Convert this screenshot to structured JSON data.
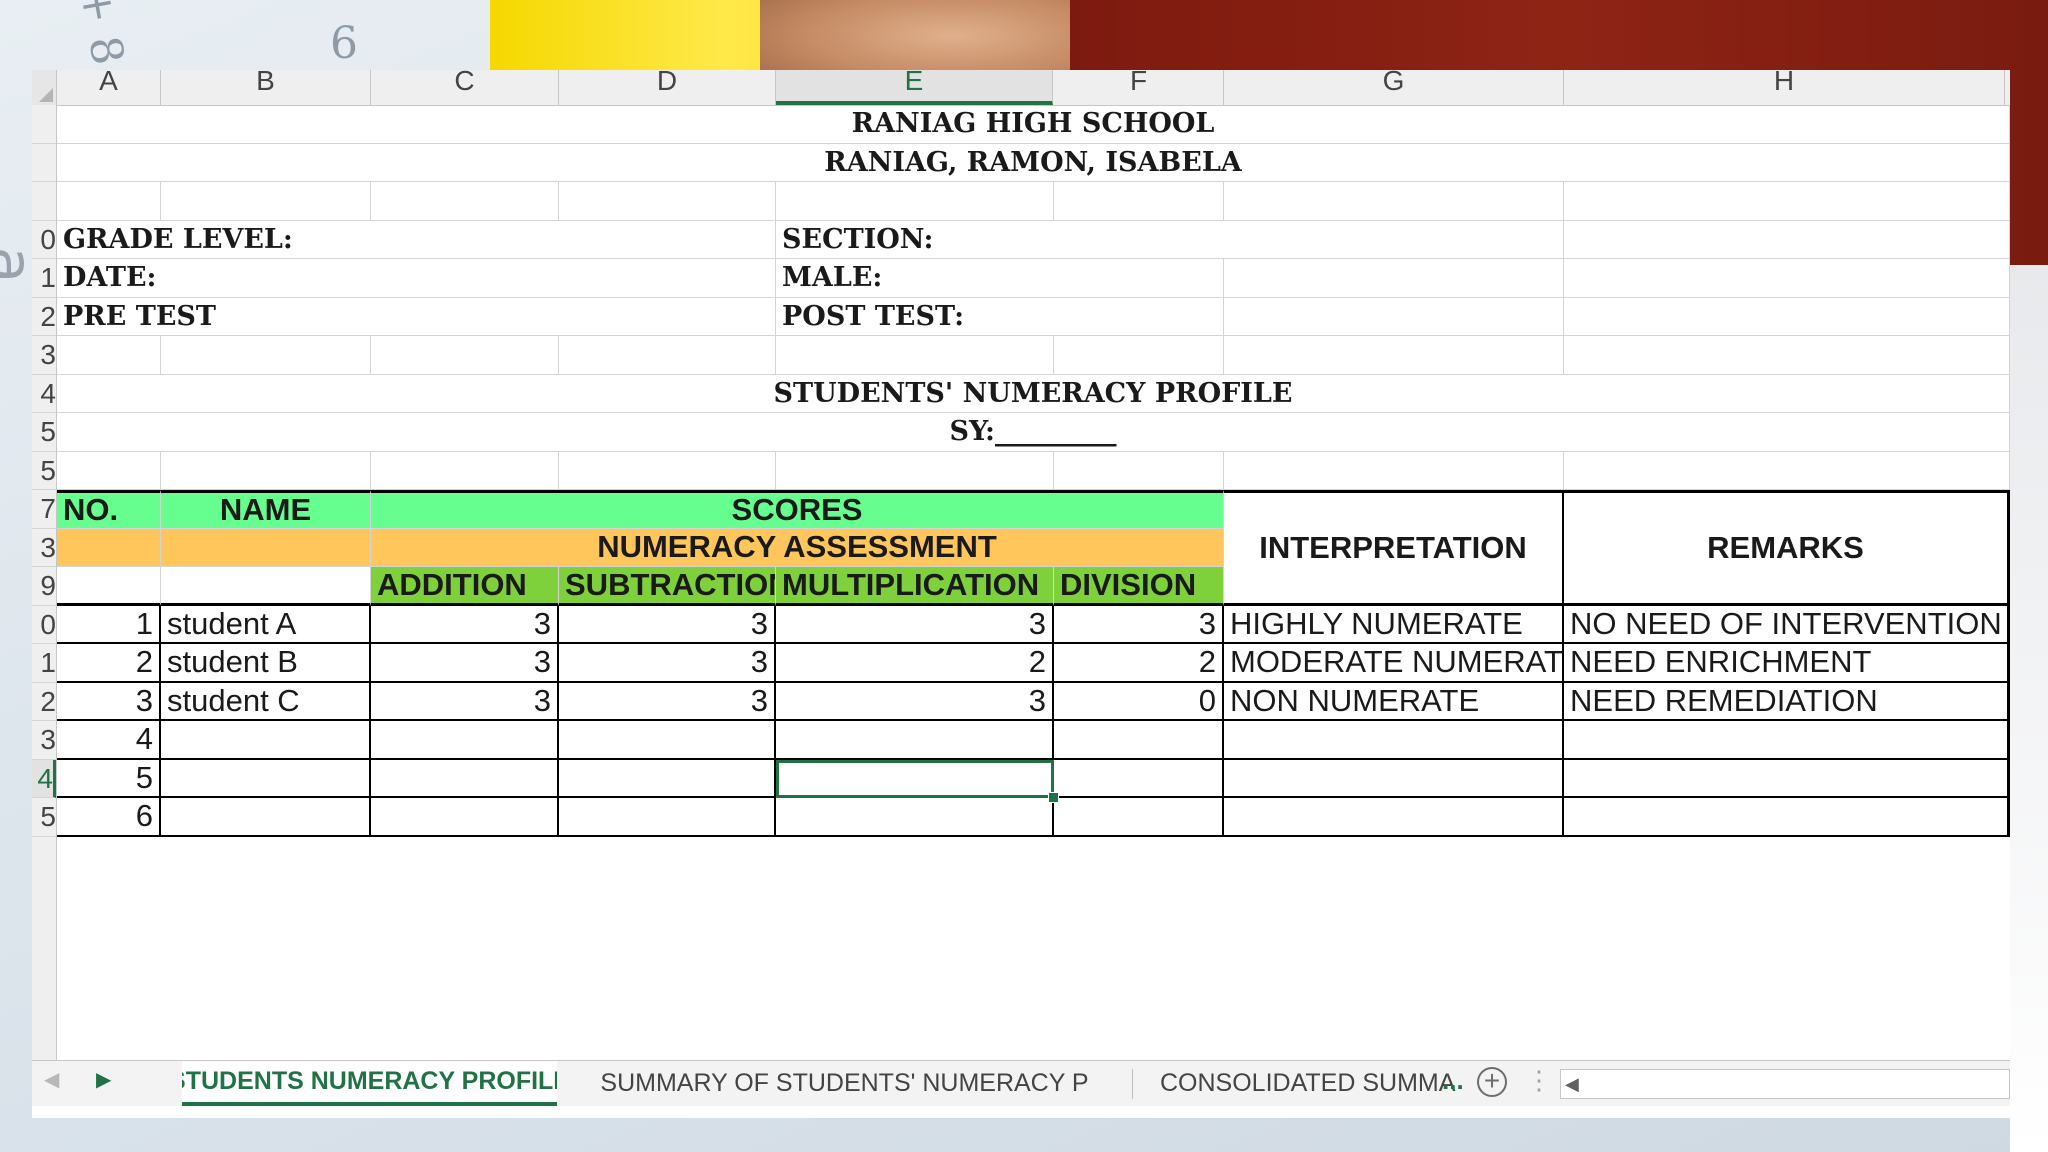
{
  "spreadsheet": {
    "columns": [
      "A",
      "B",
      "C",
      "D",
      "E",
      "F",
      "G",
      "H"
    ],
    "selected_column": "E",
    "row_numbers": [
      "",
      "",
      "",
      "0",
      "1",
      "2",
      "3",
      "4",
      "5",
      "5",
      "7",
      "3",
      "9",
      "0",
      "1",
      "2",
      "3",
      "4",
      "5"
    ],
    "selected_row_index": 17
  },
  "header": {
    "school": "RANIAG HIGH SCHOOL",
    "address": "RANIAG, RAMON, ISABELA",
    "grade_level": "GRADE LEVEL:",
    "section": "SECTION:",
    "date": "DATE:",
    "male": "MALE:",
    "pre_test": "PRE TEST",
    "post_test": "POST TEST:",
    "profile_title": "STUDENTS' NUMERACY  PROFILE",
    "sy": "SY:_________"
  },
  "table": {
    "no": "NO.",
    "name": "NAME",
    "scores": "SCORES",
    "numeracy_assessment": "NUMERACY ASSESSMENT",
    "interpretation": "INTERPRETATION",
    "remarks": "REMARKS",
    "addition": "ADDITION",
    "subtraction": "SUBTRACTION",
    "multiplication": "MULTIPLICATION",
    "division": "DIVISION",
    "rows": [
      {
        "no": "1",
        "name": "student A",
        "add": "3",
        "sub": "3",
        "mul": "3",
        "div": "3",
        "interp": "HIGHLY NUMERATE",
        "remarks": "NO NEED OF INTERVENTION"
      },
      {
        "no": "2",
        "name": "student  B",
        "add": "3",
        "sub": "3",
        "mul": "2",
        "div": "2",
        "interp": "MODERATE NUMERATE",
        "remarks": "NEED ENRICHMENT"
      },
      {
        "no": "3",
        "name": "student  C",
        "add": "3",
        "sub": "3",
        "mul": "3",
        "div": "0",
        "interp": "NON NUMERATE",
        "remarks": "NEED REMEDIATION"
      },
      {
        "no": "4",
        "name": "",
        "add": "",
        "sub": "",
        "mul": "",
        "div": "",
        "interp": "",
        "remarks": ""
      },
      {
        "no": "5",
        "name": "",
        "add": "",
        "sub": "",
        "mul": "",
        "div": "",
        "interp": "",
        "remarks": ""
      },
      {
        "no": "6",
        "name": "",
        "add": "",
        "sub": "",
        "mul": "",
        "div": "",
        "interp": "",
        "remarks": ""
      }
    ]
  },
  "tabs": {
    "active": "STUDENTS NUMERACY PROFILE",
    "second": "SUMMARY OF STUDENTS' NUMERACY P",
    "third": "CONSOLIDATED SUMMA",
    "more": "...",
    "add": "+"
  },
  "colors": {
    "excel_green": "#217346",
    "header_green": "#66ff8f",
    "header_orange": "#ffc65c",
    "header_lime": "#7fd13b"
  }
}
